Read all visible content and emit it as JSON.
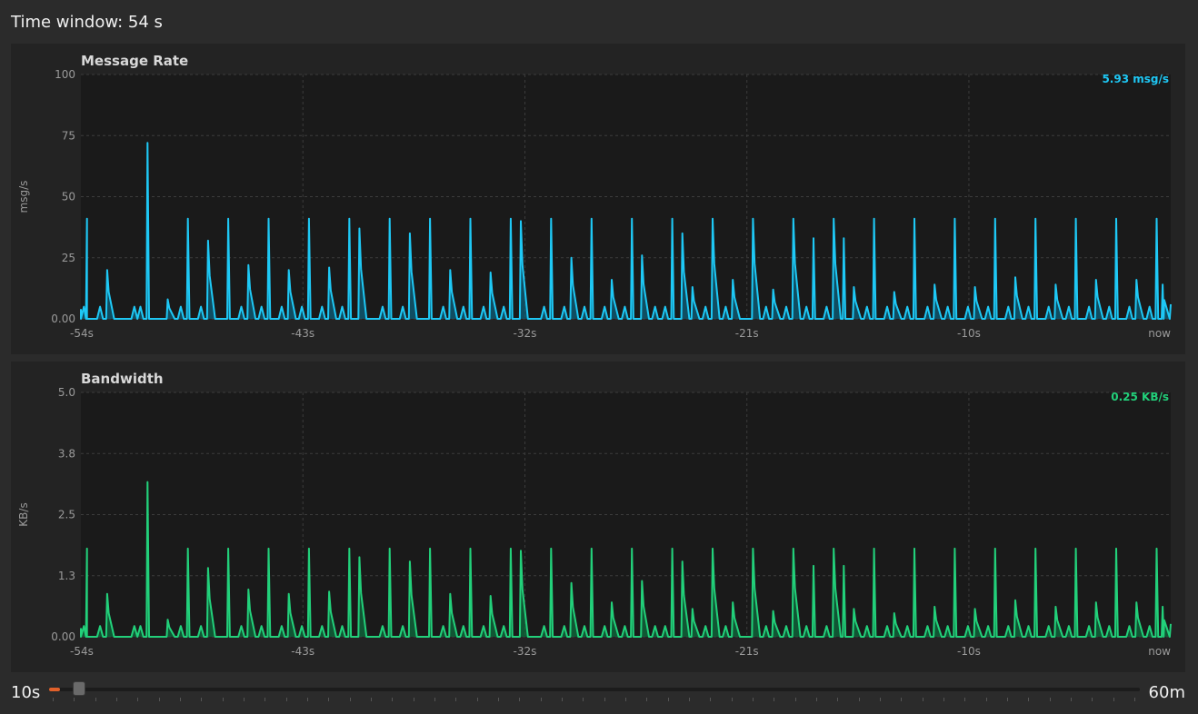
{
  "header": {
    "title": "Time window: 54 s"
  },
  "slider": {
    "min_label": "10s",
    "max_label": "60m",
    "value": 0.01,
    "tick_count": 52
  },
  "chart_data": [
    {
      "type": "area",
      "title": "Message Rate",
      "ylabel": "msg/s",
      "ylim": [
        0,
        100
      ],
      "yticks": [
        "100",
        "75",
        "50",
        "25",
        "0.00"
      ],
      "xlim": [
        -54,
        0
      ],
      "xticks": [
        {
          "value": -54,
          "label": "-54s"
        },
        {
          "value": -43,
          "label": "-43s"
        },
        {
          "value": -32,
          "label": "-32s"
        },
        {
          "value": -21,
          "label": "-21s"
        },
        {
          "value": -10,
          "label": "-10s"
        },
        {
          "value": 0,
          "label": "now"
        }
      ],
      "current_value": "5.93 msg/s",
      "color": "#1ec8f5",
      "fill": "#0d5f7a",
      "grid": true,
      "legend_position": "top-right",
      "series": [
        {
          "x": [],
          "y": []
        }
      ]
    },
    {
      "type": "area",
      "title": "Bandwidth",
      "ylabel": "KB/s",
      "ylim": [
        0,
        5
      ],
      "yticks": [
        "5.0",
        "3.8",
        "2.5",
        "1.3",
        "0.00"
      ],
      "xlim": [
        -54,
        0
      ],
      "xticks": [
        {
          "value": -54,
          "label": "-54s"
        },
        {
          "value": -43,
          "label": "-43s"
        },
        {
          "value": -32,
          "label": "-32s"
        },
        {
          "value": -21,
          "label": "-21s"
        },
        {
          "value": -10,
          "label": "-10s"
        },
        {
          "value": 0,
          "label": "now"
        }
      ],
      "current_value": "0.25 KB/s",
      "color": "#22d07a",
      "fill": "#0f6a3e",
      "grid": true,
      "legend_position": "top-right",
      "series": [
        {
          "x": [],
          "y": []
        }
      ]
    }
  ]
}
